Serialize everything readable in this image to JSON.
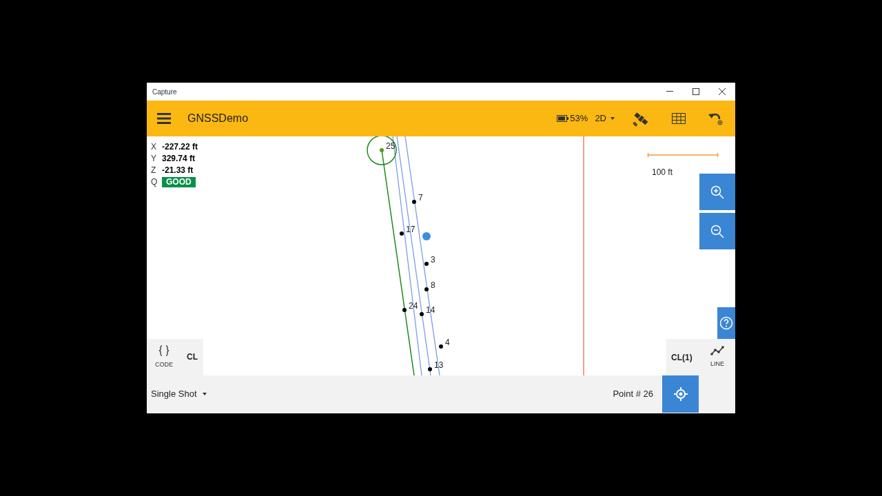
{
  "window": {
    "title": "Capture"
  },
  "header": {
    "title": "GNSSDemo",
    "battery": "53%",
    "mode": "2D"
  },
  "coordinates": [
    {
      "axis": "X",
      "value": "-227.22 ft"
    },
    {
      "axis": "Y",
      "value": "329.74 ft"
    },
    {
      "axis": "Z",
      "value": "-21.33 ft"
    }
  ],
  "quality": {
    "label": "Q",
    "value": "GOOD"
  },
  "map": {
    "scale": "100 ft",
    "points": [
      {
        "label": "25",
        "kind": "start"
      },
      {
        "label": "7",
        "kind": "point"
      },
      {
        "label": "17",
        "kind": "point"
      },
      {
        "label": "3",
        "kind": "point"
      },
      {
        "label": "8",
        "kind": "point"
      },
      {
        "label": "24",
        "kind": "point"
      },
      {
        "label": "14",
        "kind": "point"
      },
      {
        "label": "4",
        "kind": "point"
      },
      {
        "label": "13",
        "kind": "point"
      }
    ]
  },
  "code_panel": {
    "label": "CODE",
    "code": "CL"
  },
  "line_panel": {
    "code": "CL(1)",
    "label": "LINE"
  },
  "bottom_bar": {
    "mode": "Single Shot",
    "point": "Point # 26"
  }
}
